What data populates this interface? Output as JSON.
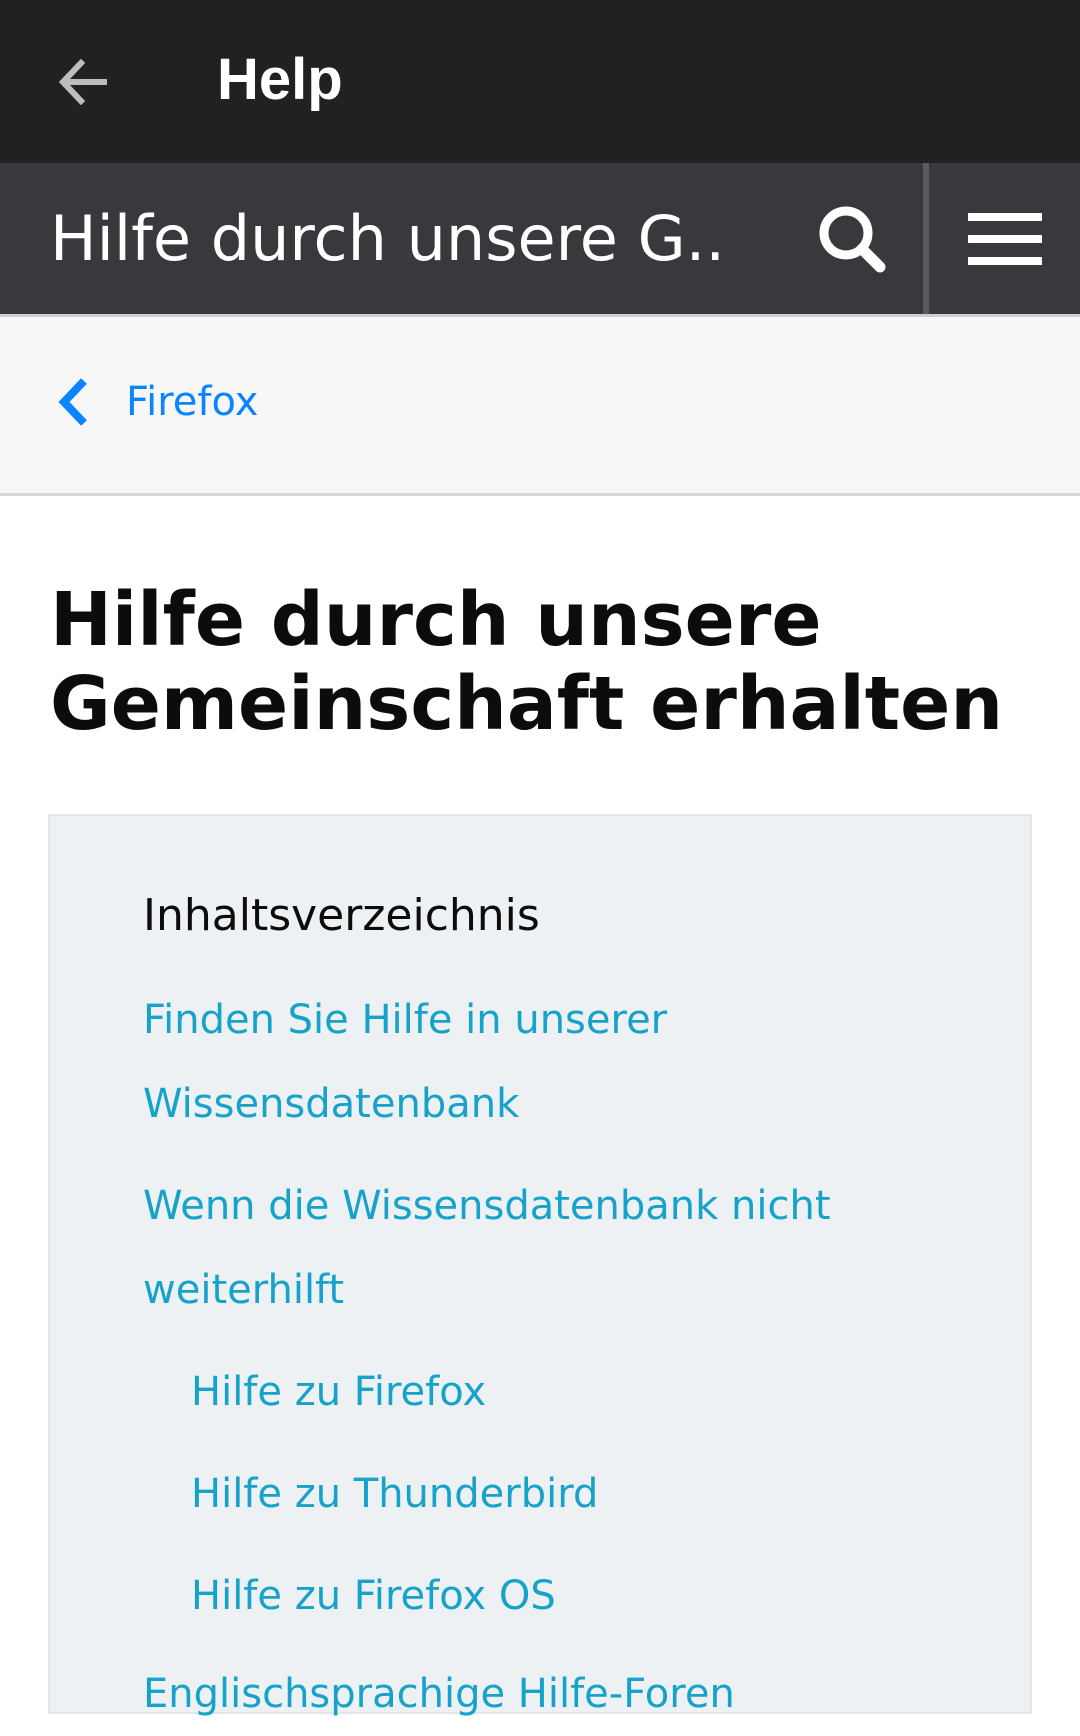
{
  "app_bar": {
    "title": "Help",
    "back_icon": "arrow-left-icon"
  },
  "site_header": {
    "title": "Hilfe durch unsere G...",
    "search_icon": "search-icon",
    "menu_icon": "hamburger-menu-icon"
  },
  "breadcrumb": {
    "label": "Firefox",
    "icon": "chevron-left-icon"
  },
  "page": {
    "title": "Hilfe durch unsere Gemeinschaft erhalten"
  },
  "toc": {
    "heading": "Inhaltsverzeichnis",
    "items": [
      {
        "label": "Finden Sie Hilfe in unserer Wissensdatenbank",
        "level": 1
      },
      {
        "label": "Wenn die Wissensdatenbank nicht weiterhilft",
        "level": 1
      },
      {
        "label": "Hilfe zu Firefox",
        "level": 2
      },
      {
        "label": "Hilfe zu Thunderbird",
        "level": 2
      },
      {
        "label": "Hilfe zu Firefox OS",
        "level": 2
      },
      {
        "label": "Englischsprachige Hilfe-Foren",
        "level": 1
      }
    ]
  },
  "colors": {
    "app_bar_bg": "#212121",
    "header_bg": "#38383d",
    "breadcrumb_link": "#0a84ff",
    "toc_link": "#16a2c9",
    "toc_bg": "#edf1f4"
  }
}
